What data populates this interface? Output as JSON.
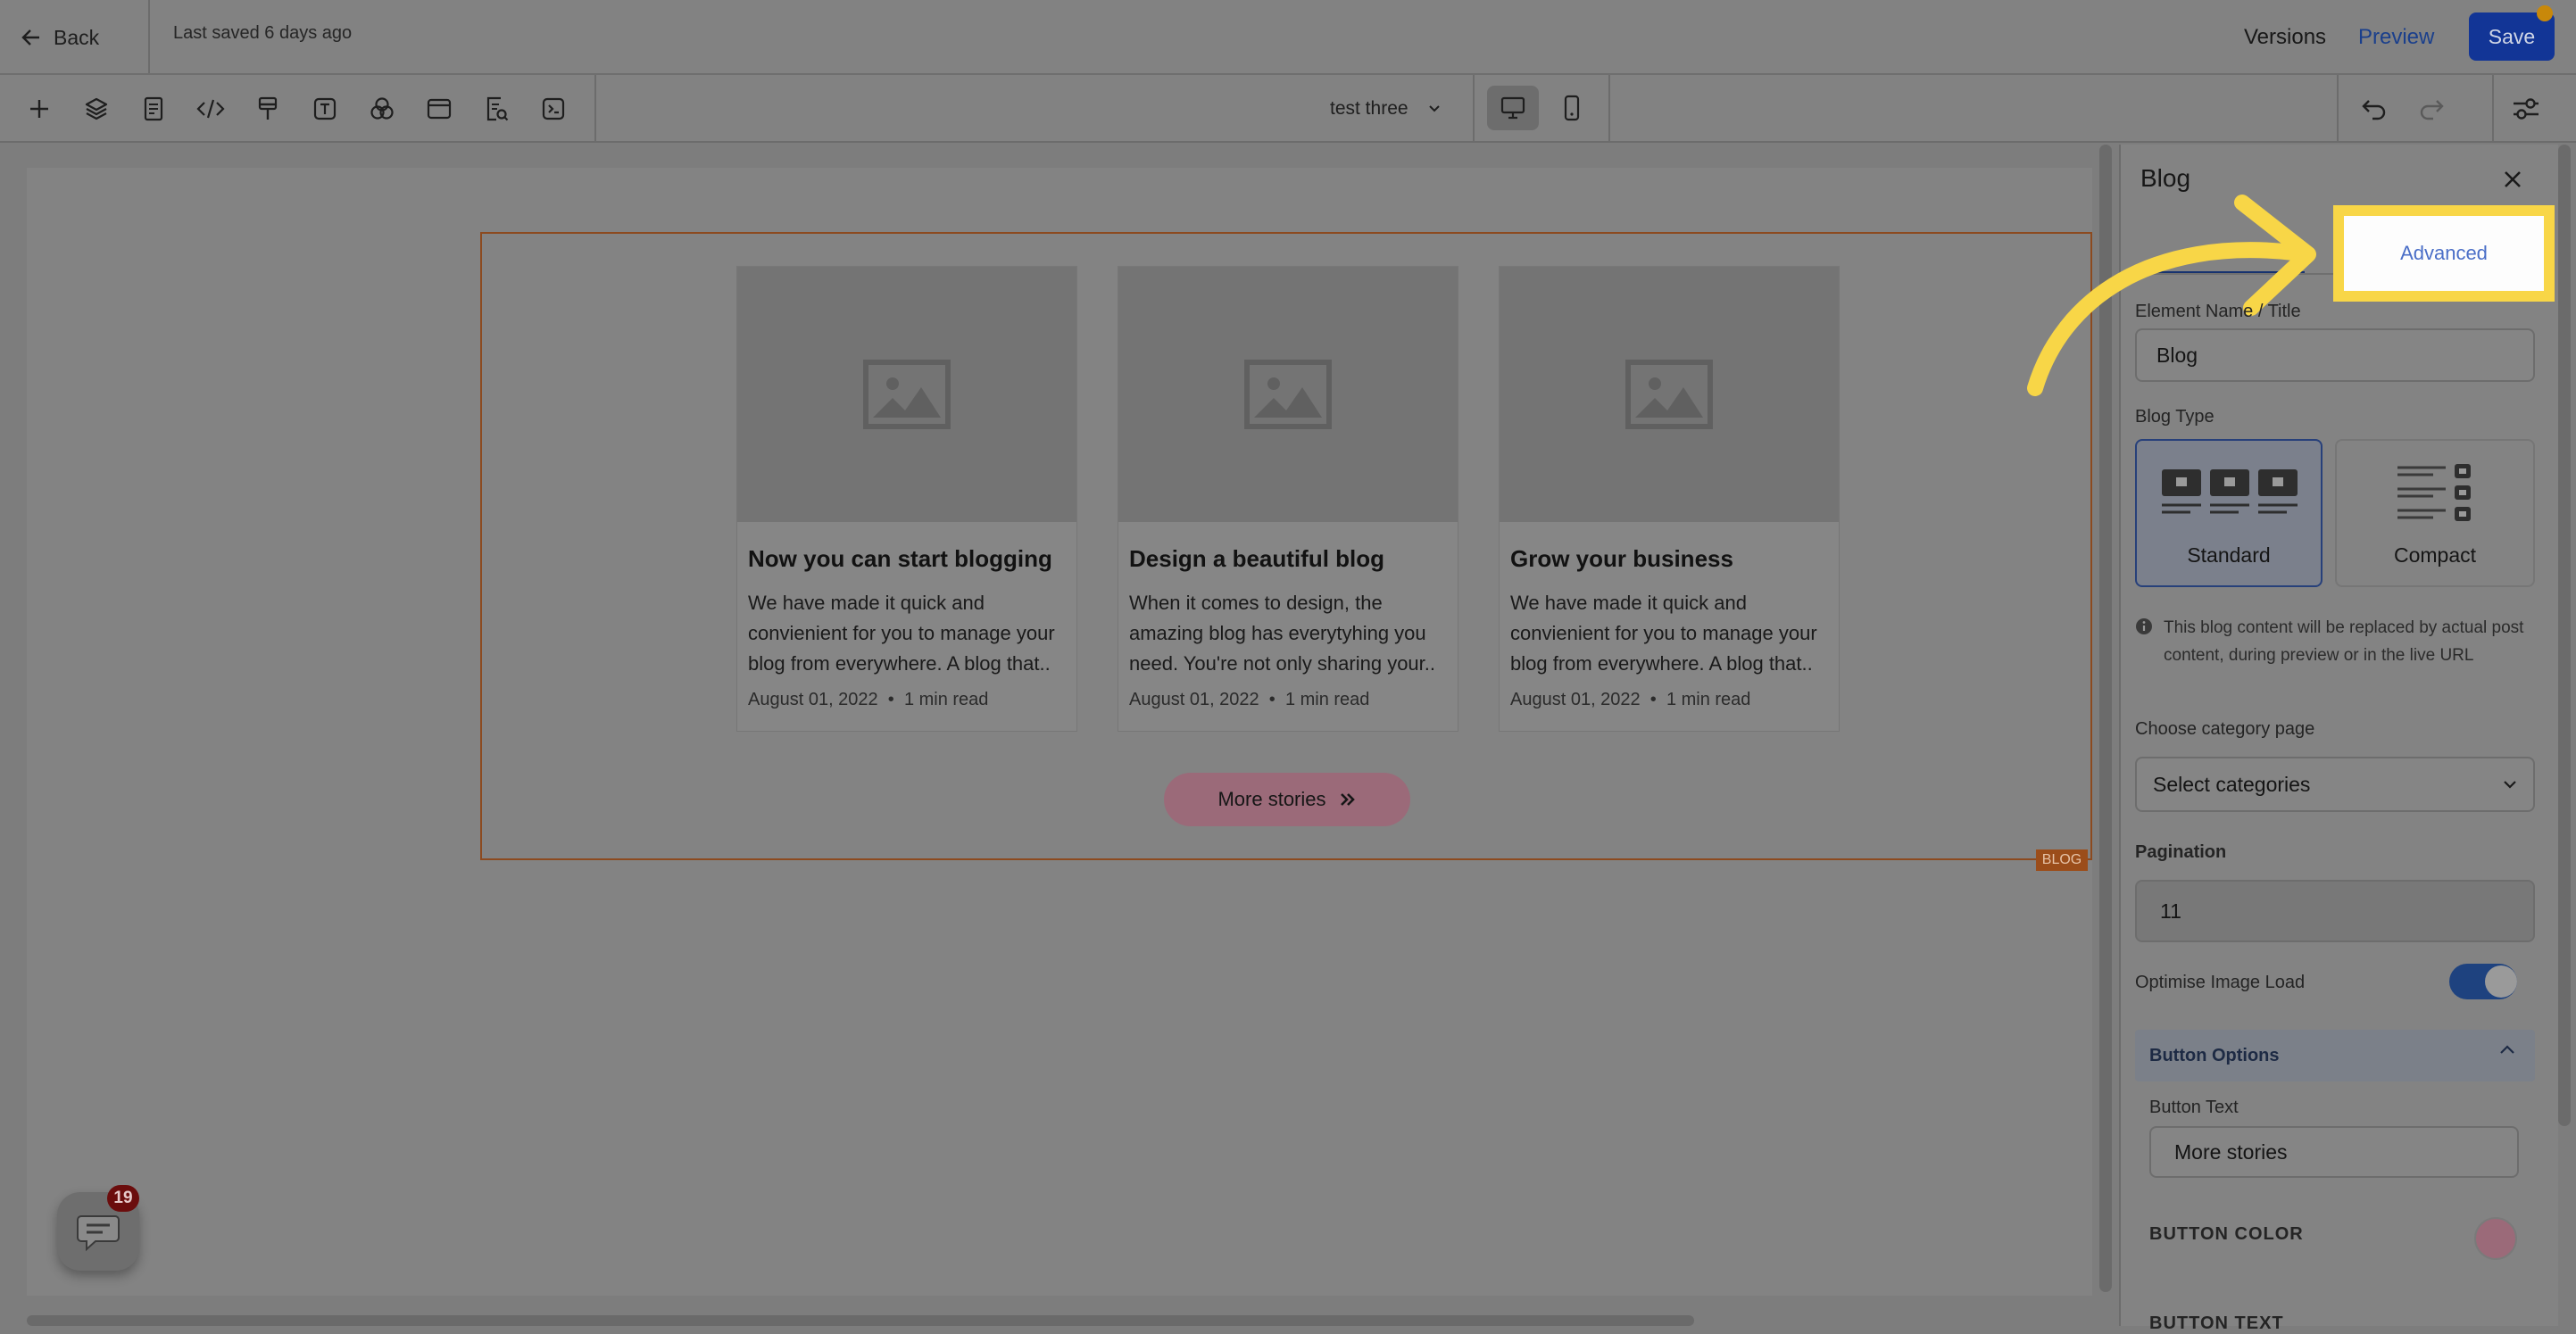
{
  "header": {
    "back_label": "Back",
    "last_saved": "Last saved 6 days ago",
    "versions_label": "Versions",
    "preview_label": "Preview",
    "save_label": "Save"
  },
  "toolbar": {
    "tools": [
      "add-icon",
      "layers-icon",
      "pages-icon",
      "code-icon",
      "paint-icon",
      "text-icon",
      "elements-icon",
      "section-icon",
      "page-settings-icon",
      "terminal-icon"
    ],
    "page_name": "test three"
  },
  "blog": {
    "tag": "BLOG",
    "posts": [
      {
        "title": "Now you can start blogging",
        "excerpt": "We have made it quick and convienient for you to manage your blog from everywhere. A blog that..",
        "date": "August 01, 2022",
        "read_time": "1 min read"
      },
      {
        "title": "Design a beautiful blog",
        "excerpt": "When it comes to design, the amazing blog has everytyhing you need. You're not only sharing your..",
        "date": "August 01, 2022",
        "read_time": "1 min read"
      },
      {
        "title": "Grow your business",
        "excerpt": "We have made it quick and convienient for you to manage your blog from everywhere. A blog that..",
        "date": "August 01, 2022",
        "read_time": "1 min read"
      }
    ],
    "more_label": "More stories"
  },
  "chat": {
    "badge": "19"
  },
  "panel": {
    "title": "Blog",
    "tab_advanced": "Advanced",
    "name_label": "Element Name / Title",
    "name_value": "Blog",
    "type_label": "Blog Type",
    "type_standard": "Standard",
    "type_compact": "Compact",
    "info_text": "This blog content will be replaced by actual post content, during preview or in the live URL",
    "category_label": "Choose category page",
    "category_value": "Select categories",
    "pagination_label": "Pagination",
    "pagination_value": "11",
    "optimise_label": "Optimise Image Load",
    "optimise_on": true,
    "button_options_title": "Button Options",
    "button_text_label": "Button Text",
    "button_text_value": "More stories",
    "button_color_label": "BUTTON COLOR",
    "button_color": "#9b6a79",
    "button_text_color_label": "BUTTON TEXT"
  },
  "colors": {
    "accent": "#123596",
    "highlight": "#f8d647",
    "blog_frame": "#8c4a1f",
    "button": "#9b6a79"
  }
}
